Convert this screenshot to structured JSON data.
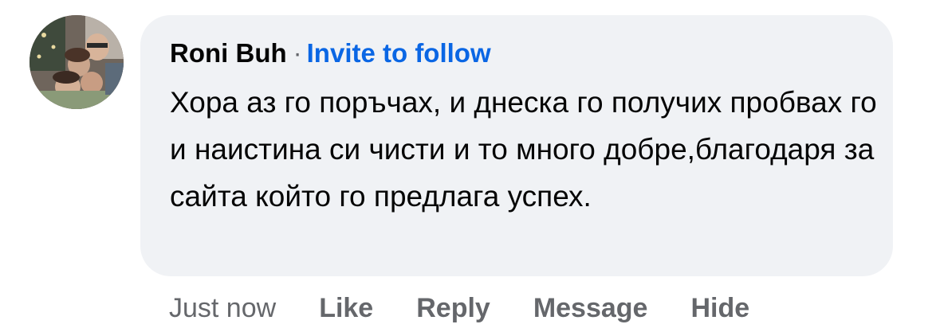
{
  "comment": {
    "author": "Roni Buh",
    "separator": "·",
    "follow_label": "Invite to follow",
    "text": "Хора аз го поръчах, и днеска го получих пробвах го и наистина си чисти и то много добре,благодаря за сайта който го предлага успех.",
    "timestamp": "Just now",
    "actions": {
      "like": "Like",
      "reply": "Reply",
      "message": "Message",
      "hide": "Hide"
    }
  },
  "colors": {
    "bubble_bg": "#f0f2f5",
    "link_blue": "#0a66e4",
    "secondary_text": "#65676b",
    "primary_text": "#050505"
  }
}
